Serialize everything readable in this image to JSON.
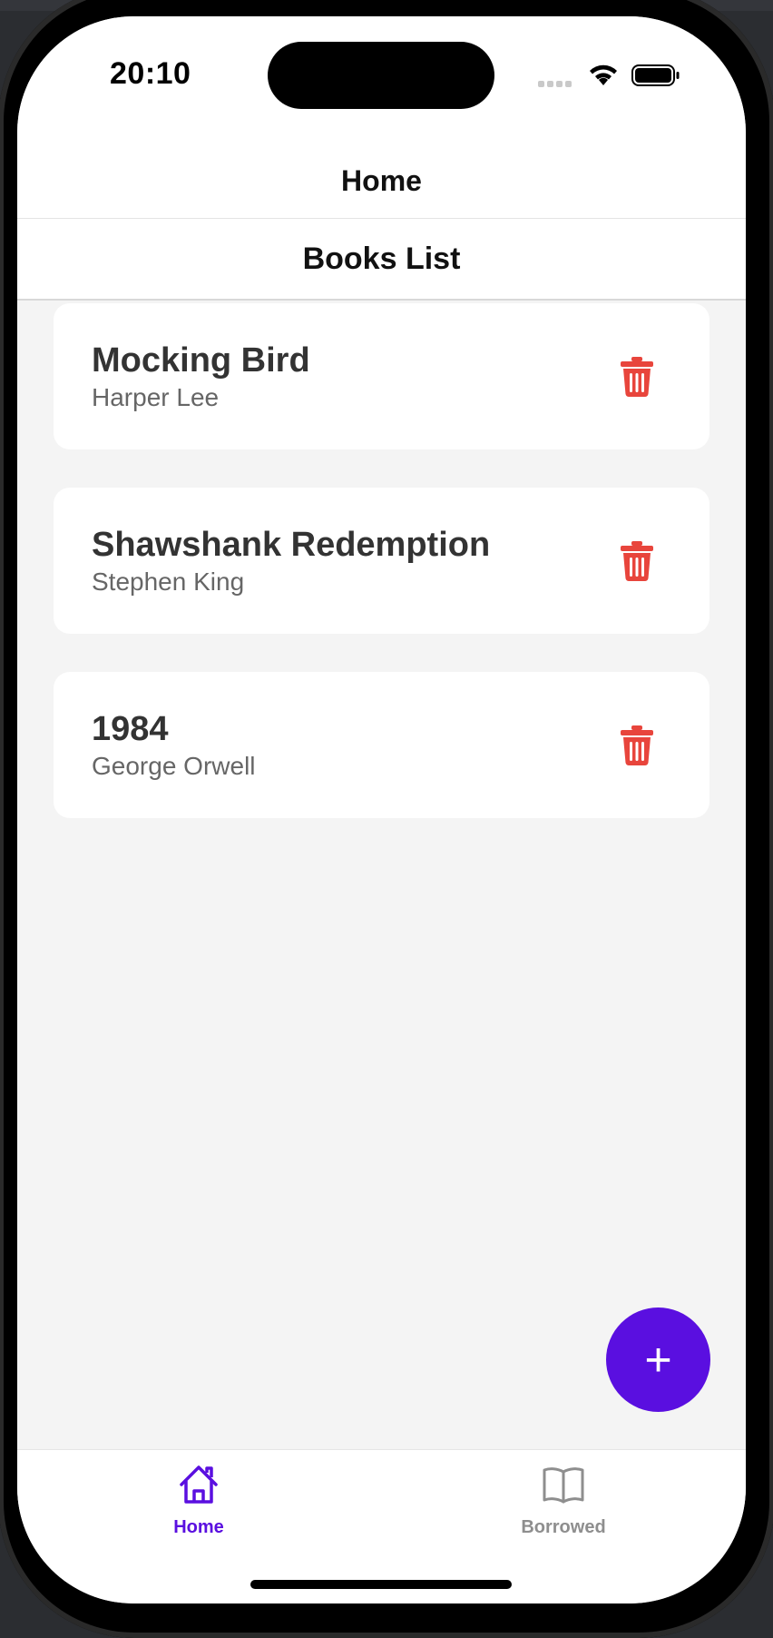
{
  "status_bar": {
    "time": "20:10"
  },
  "header": {
    "title": "Home"
  },
  "list": {
    "title": "Books List",
    "books": [
      {
        "title": "Mocking Bird",
        "author": "Harper Lee"
      },
      {
        "title": "Shawshank Redemption",
        "author": "Stephen King"
      },
      {
        "title": "1984",
        "author": "George Orwell"
      }
    ]
  },
  "fab": {
    "symbol": "+"
  },
  "tabs": [
    {
      "label": "Home",
      "icon": "home-icon",
      "active": true
    },
    {
      "label": "Borrowed",
      "icon": "book-open-icon",
      "active": false
    }
  ],
  "colors": {
    "accent": "#5a0fe0",
    "danger": "#e8453c",
    "inactive": "#8e8e8e"
  }
}
